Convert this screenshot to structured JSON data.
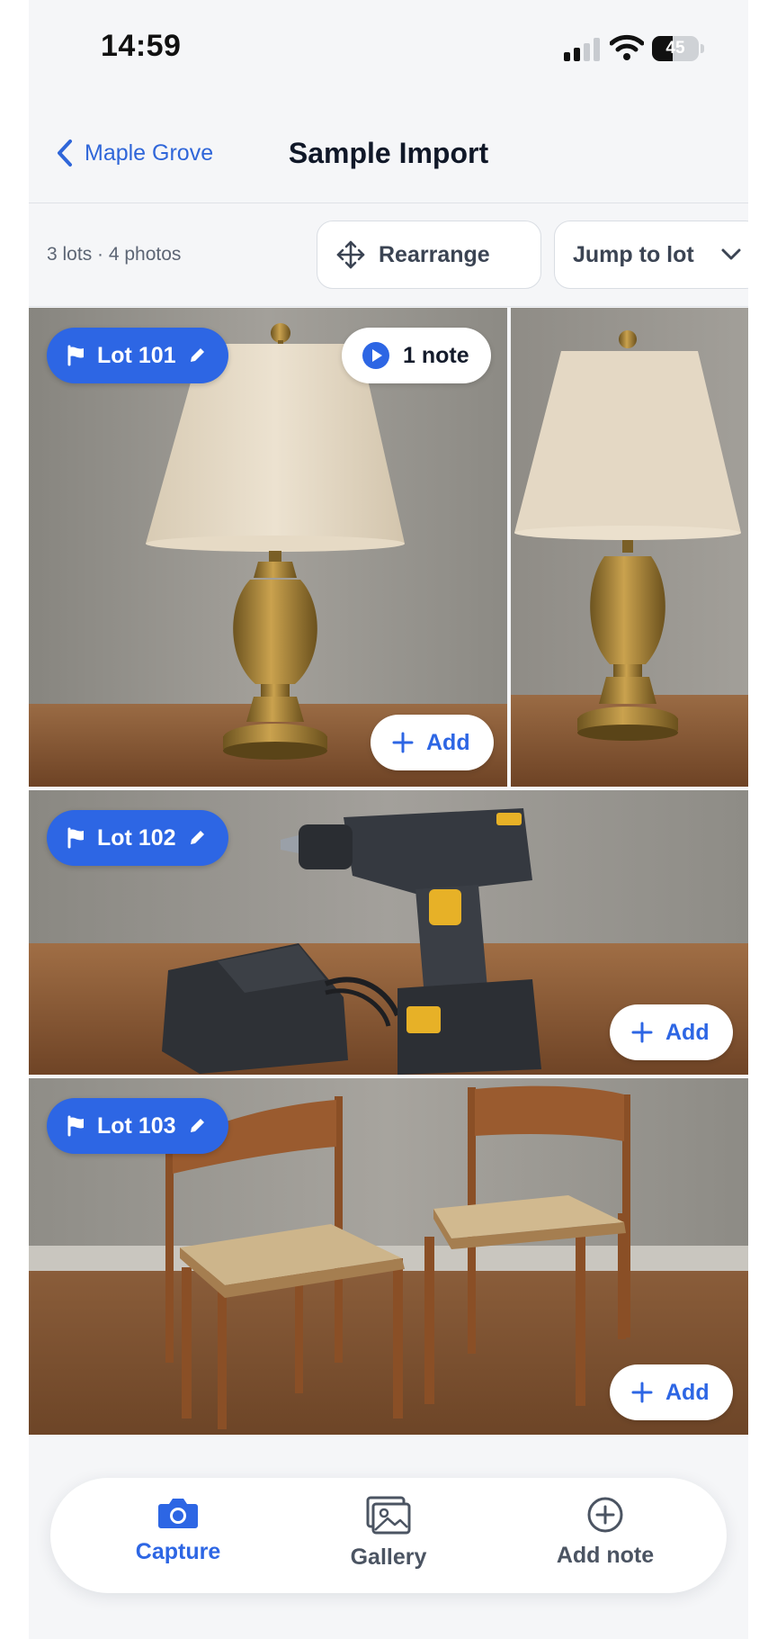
{
  "status_bar": {
    "time": "14:59",
    "battery": "45",
    "battery_level": 0.45
  },
  "nav": {
    "back_label": "Maple Grove",
    "title": "Sample Import"
  },
  "toolbar": {
    "counts": "3 lots · 4 photos",
    "rearrange_label": "Rearrange",
    "jump_label": "Jump to lot"
  },
  "lots": [
    {
      "label": "Lot 101",
      "note": "1 note",
      "add_label": "Add",
      "subject": "brass table lamp with linen shade",
      "photos": 2
    },
    {
      "label": "Lot 102",
      "add_label": "Add",
      "subject": "cordless drill with battery charger",
      "photos": 1
    },
    {
      "label": "Lot 103",
      "add_label": "Add",
      "subject": "two wooden rush-seat chairs",
      "photos": 1
    }
  ],
  "tabs": {
    "capture": "Capture",
    "gallery": "Gallery",
    "add_note": "Add note"
  },
  "colors": {
    "accent": "#2d66e4",
    "background": "#f5f6f8",
    "text": "#101828"
  },
  "icons": [
    "chevron-left-icon",
    "move-icon",
    "chevron-down-icon",
    "flag-icon",
    "pencil-icon",
    "play-icon",
    "plus-icon",
    "camera-icon",
    "gallery-icon",
    "plus-circle-icon"
  ]
}
